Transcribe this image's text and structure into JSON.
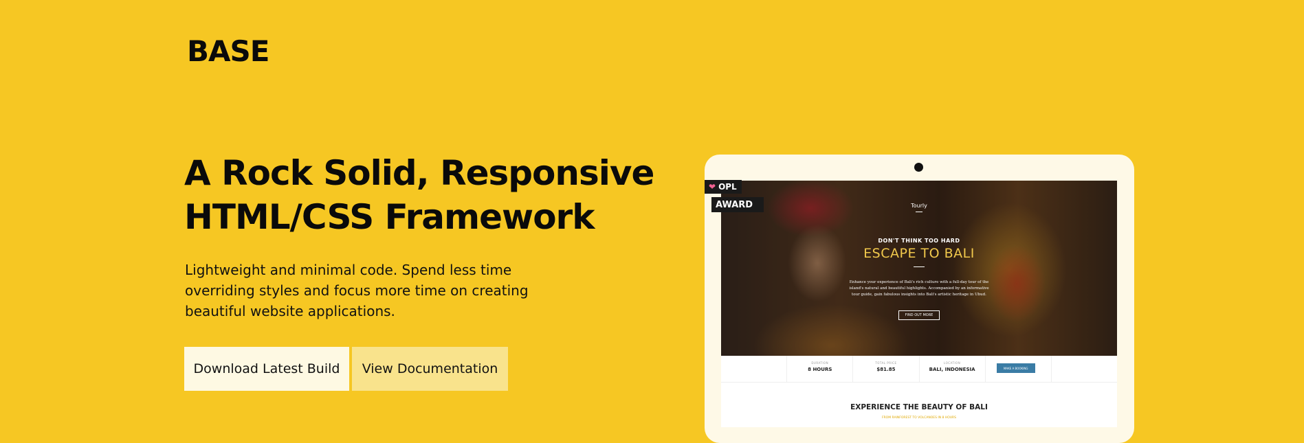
{
  "logo": "BASE",
  "hero": {
    "headline_line1": "A Rock Solid, Responsive",
    "headline_line2": "HTML/CSS Framework",
    "description": "Lightweight and minimal code. Spend less time overriding styles and focus more time on creating beautiful website applications."
  },
  "buttons": {
    "download": "Download Latest Build",
    "docs": "View Documentation"
  },
  "badges": {
    "opl": "OPL",
    "award": "AWARD"
  },
  "preview": {
    "brand": "Tourly",
    "kicker": "DON'T THINK TOO HARD",
    "title": "ESCAPE TO BALI",
    "description": "Enhance your experience of Bali's rich culture with a full-day tour of the island's natural and beautiful highlights. Accompanied by an informative tour guide, gain fabulous insights into Bali's artistic heritage in Ubud.",
    "cta": "FIND OUT MORE",
    "info": [
      {
        "label": "",
        "value": ""
      },
      {
        "label": "DURATION",
        "value": "8 HOURS"
      },
      {
        "label": "TOTAL PRICE",
        "value": "$81.85"
      },
      {
        "label": "LOCATION",
        "value": "BALI, INDONESIA"
      },
      {
        "button": "MAKE A BOOKING"
      },
      {
        "label": "",
        "value": ""
      }
    ],
    "section_title": "EXPERIENCE THE BEAUTY OF BALI",
    "section_subtitle": "FROM RAINFOREST TO VOLCANOES IN 8 HOURS"
  }
}
